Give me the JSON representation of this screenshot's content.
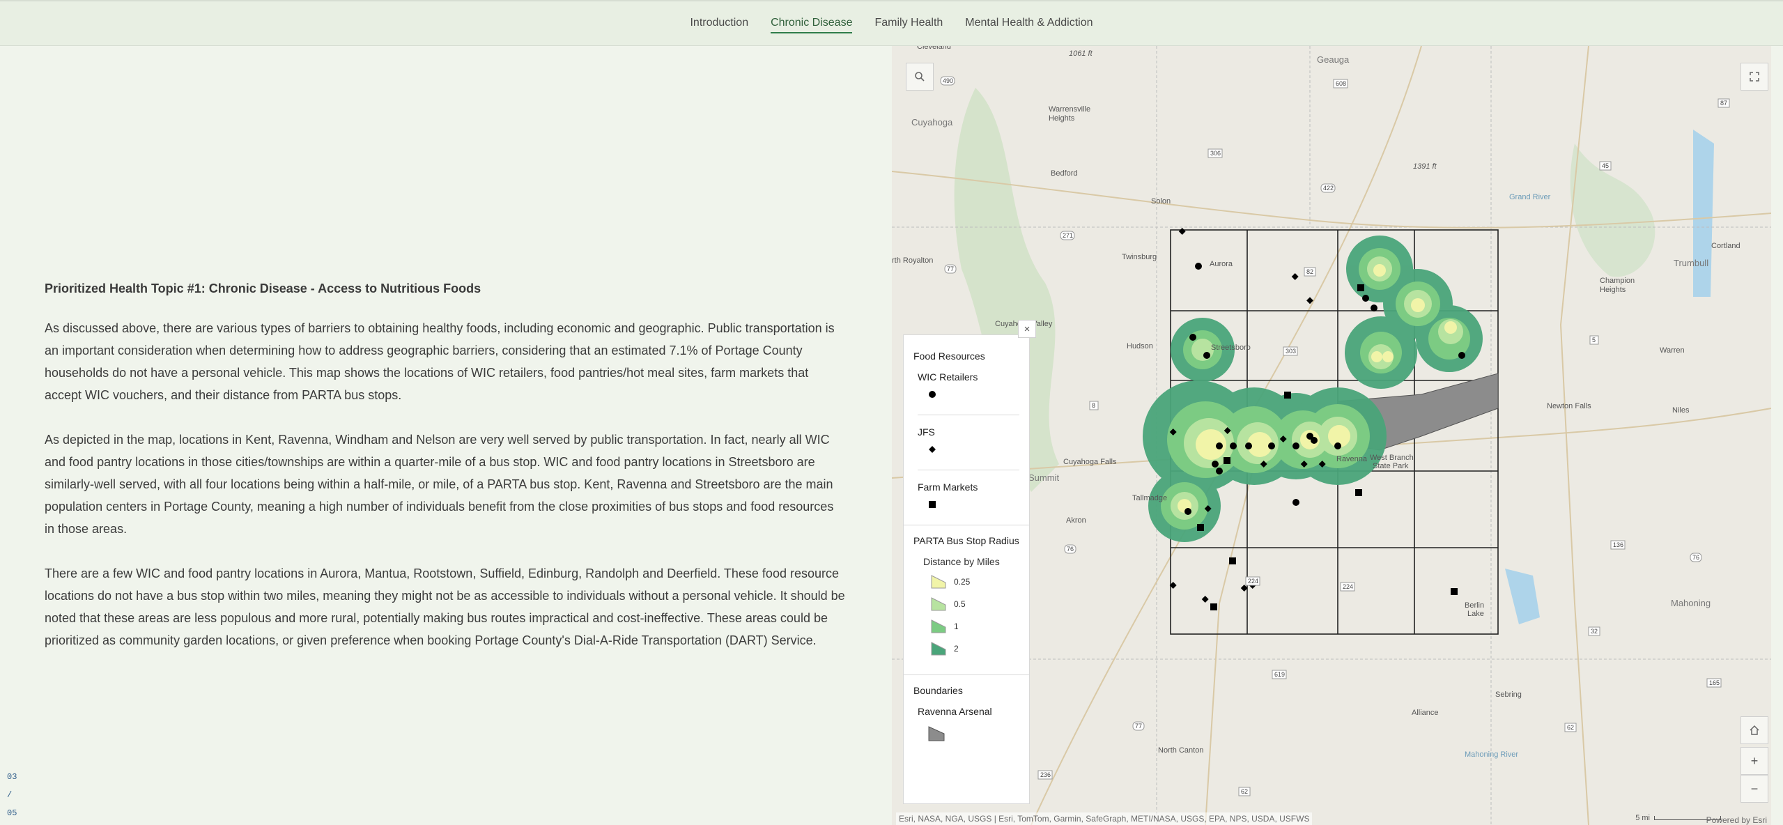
{
  "nav": {
    "tabs": [
      {
        "label": "Introduction",
        "active": false
      },
      {
        "label": "Chronic Disease",
        "active": true
      },
      {
        "label": "Family Health",
        "active": false
      },
      {
        "label": "Mental Health & Addiction",
        "active": false
      }
    ]
  },
  "narrative": {
    "heading": "Prioritized Health Topic #1: Chronic Disease - Access to Nutritious Foods",
    "paragraphs": [
      "As discussed above, there are various types of barriers to obtaining healthy foods, including economic and geographic. Public transportation is an important consideration when determining how to address geographic barriers, considering that an estimated 7.1% of Portage County households do not have a personal vehicle. This map shows the locations of WIC retailers, food pantries/hot meal sites, farm markets that accept WIC vouchers, and their distance from PARTA bus stops.",
      "As depicted in the map, locations in Kent, Ravenna, Windham and Nelson are very well served by public transportation. In fact, nearly all WIC and food pantry locations in those cities/townships are within a quarter-mile of a bus stop. WIC and food pantry locations in Streetsboro are similarly-well served, with all four locations being within a half-mile, or mile, of a PARTA bus stop. Kent, Ravenna and Streetsboro are the main population centers in Portage County, meaning a high number of individuals benefit from the close proximities of bus stops and food resources in those areas.",
      "There are a few WIC and food pantry locations in Aurora, Mantua, Rootstown, Suffield, Edinburg, Randolph and Deerfield. These food resource locations do not have a bus stop within two miles, meaning they might not be as accessible to individuals without a personal vehicle. It should be noted that these areas are less populous and more rural, potentially making bus routes impractical and cost-ineffective. These areas could be prioritized as community garden locations, or given preference when booking Portage County's Dial-A-Ride Transportation (DART) Service."
    ]
  },
  "pager": {
    "current": "03",
    "sep": "/",
    "total": "05"
  },
  "map": {
    "place_labels": [
      "Cleveland",
      "Geauga",
      "Warrensville Heights",
      "Cuyahoga",
      "Bedford",
      "Solon",
      "Twinsburg",
      "Aurora",
      "rth Royalton",
      "Hudson",
      "Streetsboro",
      "Cuyahoga Valley",
      "Cuyahoga Falls",
      "Summit",
      "Tallmadge",
      "Akron",
      "Ravenna",
      "West Branch State Park",
      "Champion Heights",
      "Trumbull",
      "Cortland",
      "Warren",
      "Newton Falls",
      "Niles",
      "Mahoning",
      "Berlin Lake",
      "Sebring",
      "Alliance",
      "North Canton",
      "1061 ft",
      "1391 ft",
      "Grand River",
      "Mahoning River"
    ],
    "route_shields": [
      "490",
      "608",
      "87",
      "306",
      "422",
      "45",
      "271",
      "77",
      "82",
      "303",
      "8",
      "5",
      "76",
      "136",
      "76",
      "224",
      "32",
      "619",
      "165",
      "77",
      "62",
      "236",
      "62"
    ],
    "attribution": "Esri, NASA, NGA, USGS | Esri, TomTom, Garmin, SafeGraph, METI/NASA, USGS, EPA, NPS, USDA, USFWS",
    "powered_by": "Powered by Esri",
    "scale_label": "5 mi",
    "buttons": {
      "search": "search",
      "expand": "expand",
      "home": "home",
      "zoom_in": "+",
      "zoom_out": "−"
    }
  },
  "legend": {
    "close": "×",
    "food_title": "Food Resources",
    "wic": "WIC Retailers",
    "jfs": "JFS",
    "farm": "Farm Markets",
    "radius_title": "PARTA Bus Stop Radius",
    "radius_sub": "Distance by Miles",
    "radius_items": [
      {
        "label": "0.25",
        "color": "#f1f4a8"
      },
      {
        "label": "0.5",
        "color": "#b7e3a0"
      },
      {
        "label": "1",
        "color": "#7ccb83"
      },
      {
        "label": "2",
        "color": "#4aa57a"
      }
    ],
    "boundaries_title": "Boundaries",
    "arsenal": "Ravenna Arsenal",
    "arsenal_color": "#8c8c8c"
  }
}
